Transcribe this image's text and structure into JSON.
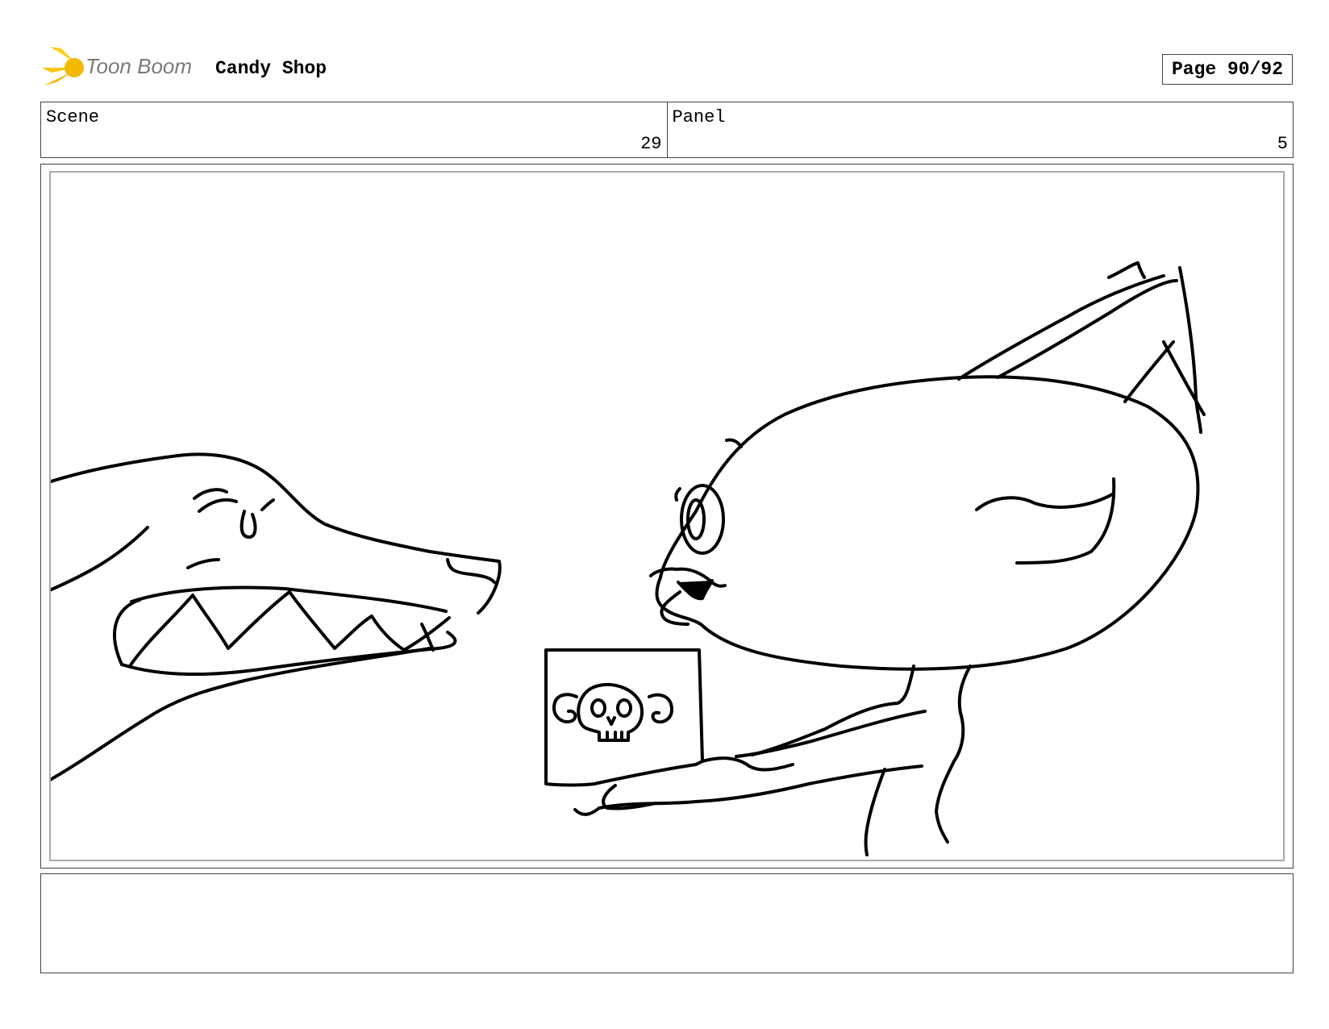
{
  "header": {
    "logo_text": "Toon Boom",
    "project_title": "Candy Shop",
    "page_label": "Page 90/92"
  },
  "info": {
    "scene_label": "Scene",
    "scene_value": "29",
    "panel_label": "Panel",
    "panel_value": "5"
  },
  "panel": {
    "drawing_icon": "storyboard-sketch"
  },
  "notes": {
    "text": ""
  },
  "colors": {
    "logo_accent": "#f5b800",
    "logo_text": "#7a7a7a",
    "border": "#444444",
    "inner_border": "#aaaaaa"
  }
}
